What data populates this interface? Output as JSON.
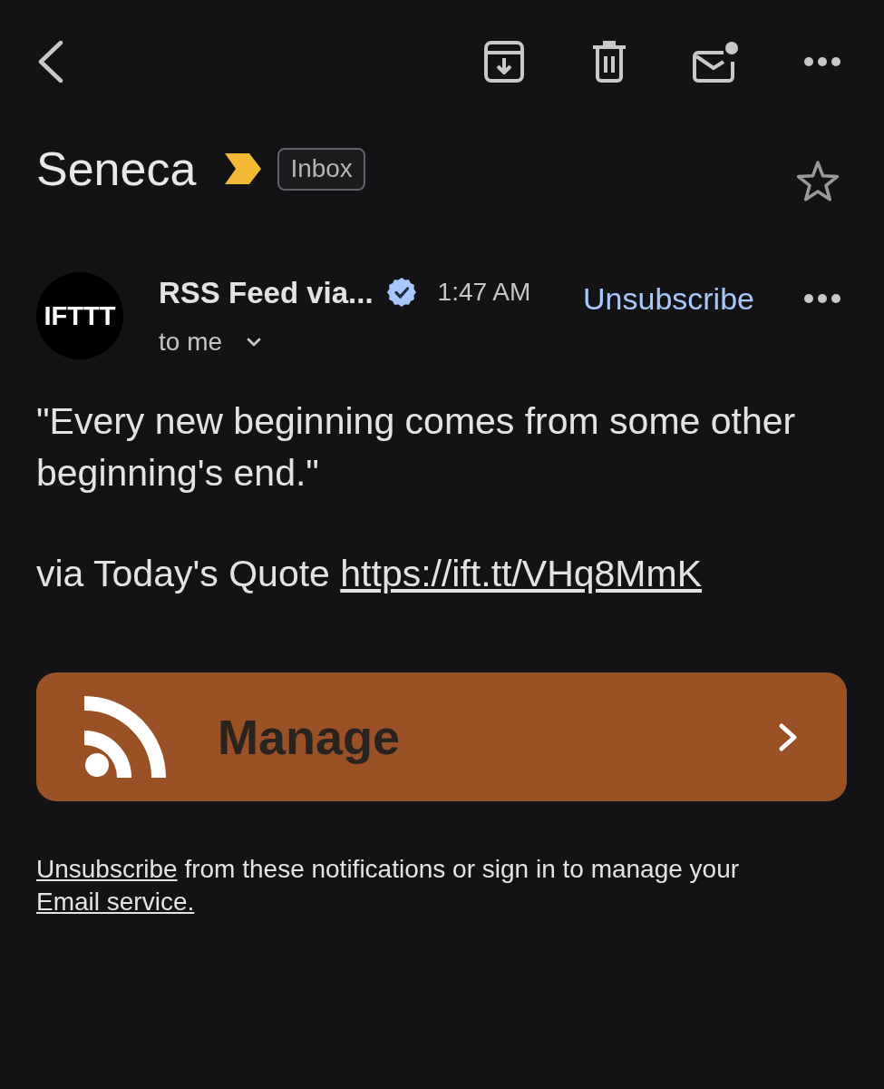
{
  "subject": {
    "title": "Seneca",
    "important": true,
    "label": "Inbox",
    "starred": false
  },
  "message": {
    "avatar": "IFTTT",
    "sender": "RSS Feed via...",
    "verified": true,
    "time": "1:47 AM",
    "unsubscribe": "Unsubscribe",
    "recipient": "to me"
  },
  "body": [
    {
      "text": "\"Every new beginning comes from some other beginning's end.\""
    },
    {
      "text": "via Today's Quote",
      "link": "https://ift.tt/VHq8MmK"
    }
  ],
  "action_button": {
    "label": "Manage"
  },
  "footer": [
    {
      "kind": "link",
      "text": "Unsubscribe"
    },
    {
      "kind": "text",
      "text": "from these notifications or sign in to manage your"
    },
    {
      "kind": "link",
      "text": "Email service."
    }
  ]
}
